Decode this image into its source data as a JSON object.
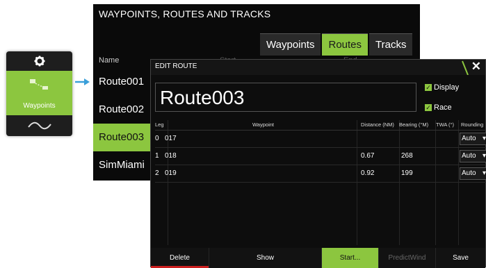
{
  "side_panel": {
    "waypoints_label": "Waypoints"
  },
  "window": {
    "title": "WAYPOINTS, ROUTES AND TRACKS",
    "tabs": [
      "Waypoints",
      "Routes",
      "Tracks"
    ],
    "active_tab": "Routes",
    "column_name": "Name",
    "column_start": "Start",
    "column_end": "End",
    "routes": [
      "Route001",
      "Route002",
      "Route003",
      "SimMiami"
    ],
    "selected_route": "Route003"
  },
  "dialog": {
    "title": "EDIT ROUTE",
    "route_name": "Route003",
    "display_label": "Display",
    "race_label": "Race",
    "columns": {
      "leg": "Leg",
      "waypoint": "Waypoint",
      "distance": "Distance (NM)",
      "bearing": "Bearing (°M)",
      "twa": "TWA (°)",
      "rounding": "Rounding"
    },
    "rows": [
      {
        "leg": "0",
        "waypoint": "017",
        "distance": "",
        "bearing": "",
        "rounding": "Auto"
      },
      {
        "leg": "1",
        "waypoint": "018",
        "distance": "0.67",
        "bearing": "268",
        "rounding": "Auto"
      },
      {
        "leg": "2",
        "waypoint": "019",
        "distance": "0.92",
        "bearing": "199",
        "rounding": "Auto"
      }
    ],
    "buttons": {
      "delete": "Delete",
      "show": "Show",
      "start": "Start...",
      "predictwind": "PredictWind",
      "save": "Save"
    }
  },
  "colors": {
    "accent": "#8cc63f",
    "delete_underline": "#cc1f1f",
    "arrow": "#3a9fd9"
  }
}
